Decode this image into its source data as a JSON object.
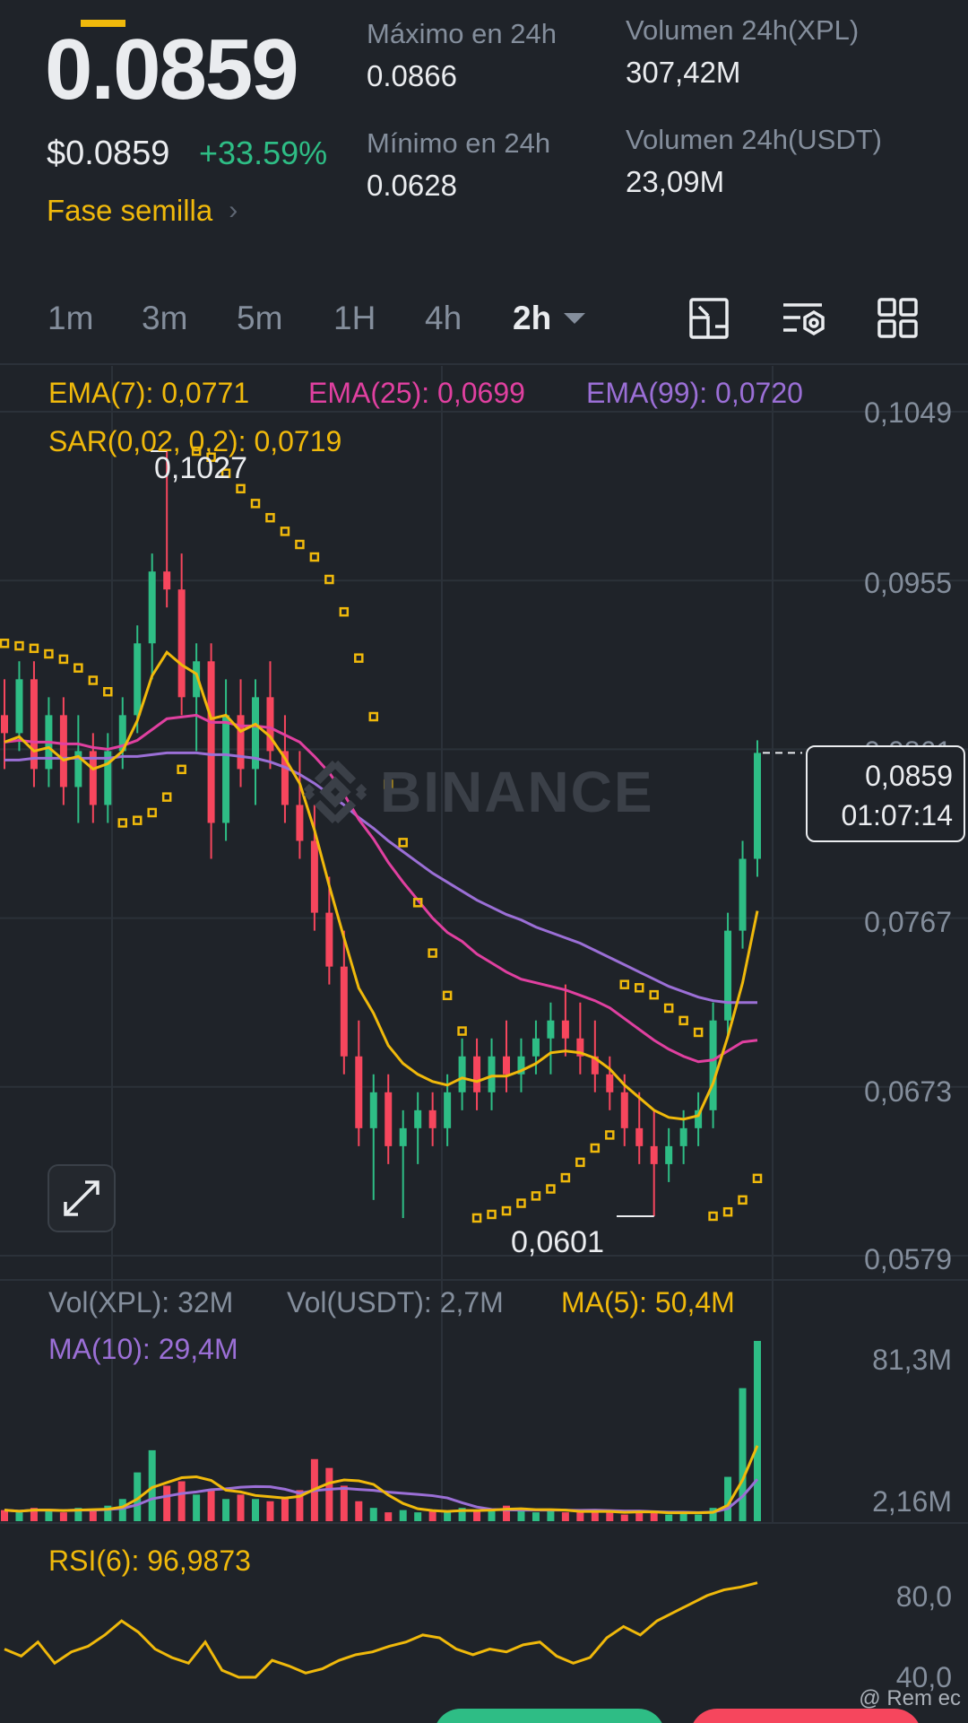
{
  "header": {
    "price": "0.0859",
    "price_usd": "$0.0859",
    "change": "+33.59%",
    "seed_label": "Fase semilla",
    "stats": [
      {
        "label": "Máximo en 24h",
        "value": "0.0866"
      },
      {
        "label": "Volumen 24h(XPL)",
        "value": "307,42M"
      },
      {
        "label": "Mínimo en 24h",
        "value": "0.0628"
      },
      {
        "label": "Volumen 24h(USDT)",
        "value": "23,09M"
      }
    ]
  },
  "intervals": [
    "1m",
    "3m",
    "5m",
    "1H",
    "4h",
    "2h"
  ],
  "active_interval": "2h",
  "indicators": {
    "ema7": "EMA(7): 0,0771",
    "ema25": "EMA(25): 0,0699",
    "ema99": "EMA(99): 0,0720",
    "sar": "SAR(0,02, 0,2): 0,0719",
    "vol_xpl": "Vol(XPL): 32M",
    "vol_usdt": "Vol(USDT): 2,7M",
    "ma5": "MA(5): 50,4M",
    "ma10": "MA(10): 29,4M",
    "rsi": "RSI(6): 96,9873"
  },
  "price_axis": [
    "0,1049",
    "0,0955",
    "0,0861",
    "0,0767",
    "0,0673",
    "0,0579"
  ],
  "volume_axis": [
    "81,3M",
    "2,16M"
  ],
  "rsi_axis": [
    "80,0",
    "40,0"
  ],
  "current_price_tag": {
    "price": "0,0859",
    "countdown": "01:07:14"
  },
  "annotations": {
    "high": "0,1027",
    "low": "0,0601"
  },
  "watermark": "BINANCE",
  "footer_credit": "@ Rem ec",
  "colors": {
    "up": "#2ebd85",
    "down": "#f6465d",
    "ema7": "#f0b90b",
    "ema25": "#e040a0",
    "ema99": "#9b6fd6",
    "sar": "#f0b90b",
    "accent": "#f0b90b",
    "bg": "#1f2329"
  },
  "chart_data": {
    "type": "candlestick",
    "ylim": [
      0.0579,
      0.1049
    ],
    "candles": [
      [
        0.088,
        0.09,
        0.085,
        0.087
      ],
      [
        0.087,
        0.091,
        0.086,
        0.09
      ],
      [
        0.09,
        0.091,
        0.084,
        0.085
      ],
      [
        0.085,
        0.089,
        0.084,
        0.088
      ],
      [
        0.088,
        0.089,
        0.083,
        0.084
      ],
      [
        0.084,
        0.088,
        0.082,
        0.086
      ],
      [
        0.086,
        0.087,
        0.082,
        0.083
      ],
      [
        0.083,
        0.087,
        0.082,
        0.086
      ],
      [
        0.086,
        0.089,
        0.085,
        0.088
      ],
      [
        0.088,
        0.093,
        0.087,
        0.092
      ],
      [
        0.092,
        0.097,
        0.09,
        0.096
      ],
      [
        0.096,
        0.1027,
        0.094,
        0.095
      ],
      [
        0.095,
        0.097,
        0.088,
        0.089
      ],
      [
        0.089,
        0.092,
        0.086,
        0.091
      ],
      [
        0.091,
        0.092,
        0.08,
        0.082
      ],
      [
        0.082,
        0.09,
        0.081,
        0.088
      ],
      [
        0.088,
        0.09,
        0.084,
        0.085
      ],
      [
        0.085,
        0.09,
        0.083,
        0.089
      ],
      [
        0.089,
        0.091,
        0.085,
        0.086
      ],
      [
        0.086,
        0.088,
        0.082,
        0.083
      ],
      [
        0.083,
        0.086,
        0.08,
        0.081
      ],
      [
        0.081,
        0.083,
        0.076,
        0.077
      ],
      [
        0.077,
        0.079,
        0.073,
        0.074
      ],
      [
        0.074,
        0.076,
        0.068,
        0.069
      ],
      [
        0.069,
        0.071,
        0.064,
        0.065
      ],
      [
        0.065,
        0.068,
        0.061,
        0.067
      ],
      [
        0.067,
        0.068,
        0.063,
        0.064
      ],
      [
        0.064,
        0.066,
        0.06,
        0.065
      ],
      [
        0.065,
        0.067,
        0.063,
        0.066
      ],
      [
        0.066,
        0.067,
        0.064,
        0.065
      ],
      [
        0.065,
        0.068,
        0.064,
        0.067
      ],
      [
        0.067,
        0.07,
        0.066,
        0.069
      ],
      [
        0.069,
        0.07,
        0.066,
        0.067
      ],
      [
        0.067,
        0.07,
        0.066,
        0.069
      ],
      [
        0.069,
        0.071,
        0.067,
        0.068
      ],
      [
        0.068,
        0.07,
        0.067,
        0.069
      ],
      [
        0.069,
        0.071,
        0.068,
        0.07
      ],
      [
        0.07,
        0.072,
        0.068,
        0.071
      ],
      [
        0.071,
        0.073,
        0.069,
        0.07
      ],
      [
        0.07,
        0.072,
        0.068,
        0.069
      ],
      [
        0.069,
        0.071,
        0.067,
        0.068
      ],
      [
        0.068,
        0.069,
        0.066,
        0.067
      ],
      [
        0.067,
        0.068,
        0.064,
        0.065
      ],
      [
        0.065,
        0.067,
        0.063,
        0.064
      ],
      [
        0.064,
        0.066,
        0.0601,
        0.063
      ],
      [
        0.063,
        0.065,
        0.062,
        0.064
      ],
      [
        0.064,
        0.066,
        0.063,
        0.065
      ],
      [
        0.065,
        0.067,
        0.064,
        0.066
      ],
      [
        0.066,
        0.072,
        0.065,
        0.071
      ],
      [
        0.071,
        0.077,
        0.07,
        0.076
      ],
      [
        0.076,
        0.081,
        0.075,
        0.08
      ],
      [
        0.08,
        0.0866,
        0.079,
        0.0859
      ]
    ],
    "ema7": [
      0.0865,
      0.0868,
      0.086,
      0.0862,
      0.0855,
      0.0857,
      0.085,
      0.0853,
      0.086,
      0.0877,
      0.0902,
      0.0915,
      0.0908,
      0.0903,
      0.0878,
      0.088,
      0.0871,
      0.0875,
      0.0868,
      0.0856,
      0.0842,
      0.0816,
      0.0785,
      0.0756,
      0.0728,
      0.0714,
      0.0696,
      0.0686,
      0.068,
      0.0676,
      0.0674,
      0.0678,
      0.0676,
      0.0679,
      0.0679,
      0.0682,
      0.0686,
      0.0692,
      0.0693,
      0.0692,
      0.0689,
      0.0683,
      0.0674,
      0.0667,
      0.066,
      0.0656,
      0.0655,
      0.0657,
      0.0675,
      0.0701,
      0.0731,
      0.0771
    ],
    "ema25": [
      0.0865,
      0.0866,
      0.0865,
      0.0865,
      0.0864,
      0.0864,
      0.0862,
      0.0861,
      0.0863,
      0.0866,
      0.0872,
      0.0878,
      0.0879,
      0.088,
      0.0876,
      0.0876,
      0.0874,
      0.0874,
      0.0873,
      0.0869,
      0.0865,
      0.0857,
      0.0848,
      0.0836,
      0.0822,
      0.0811,
      0.0798,
      0.0787,
      0.0777,
      0.0767,
      0.0759,
      0.0754,
      0.0747,
      0.0742,
      0.0737,
      0.0733,
      0.0731,
      0.0729,
      0.0727,
      0.0724,
      0.0721,
      0.0717,
      0.0711,
      0.0705,
      0.0699,
      0.0694,
      0.069,
      0.0687,
      0.0688,
      0.0693,
      0.0698,
      0.0699
    ],
    "ema99": [
      0.0855,
      0.0855,
      0.0856,
      0.0856,
      0.0856,
      0.0856,
      0.0856,
      0.0856,
      0.0857,
      0.0857,
      0.0858,
      0.0859,
      0.0859,
      0.0859,
      0.0858,
      0.0858,
      0.0857,
      0.0856,
      0.0854,
      0.0851,
      0.0847,
      0.0842,
      0.0836,
      0.083,
      0.0823,
      0.0817,
      0.081,
      0.0804,
      0.0798,
      0.0792,
      0.0787,
      0.0782,
      0.0777,
      0.0773,
      0.0769,
      0.0766,
      0.0762,
      0.0759,
      0.0756,
      0.0753,
      0.0749,
      0.0745,
      0.0741,
      0.0737,
      0.0733,
      0.0729,
      0.0726,
      0.0723,
      0.0721,
      0.072,
      0.072,
      0.072
    ],
    "volume_max_m": 81.3,
    "volumes_m": [
      5,
      4,
      6,
      5,
      4,
      6,
      5,
      7,
      10,
      22,
      32,
      16,
      18,
      12,
      14,
      10,
      12,
      10,
      9,
      11,
      14,
      28,
      24,
      16,
      9,
      6,
      4,
      5,
      4,
      5,
      4,
      6,
      5,
      5,
      7,
      5,
      4,
      5,
      4,
      4,
      5,
      4,
      3,
      5,
      4,
      3,
      4,
      3,
      6,
      20,
      60,
      81.3
    ],
    "rsi": [
      50,
      45,
      55,
      40,
      48,
      52,
      60,
      70,
      62,
      50,
      44,
      40,
      55,
      35,
      30,
      30,
      42,
      38,
      33,
      36,
      42,
      46,
      48,
      52,
      55,
      60,
      58,
      50,
      46,
      50,
      48,
      53,
      55,
      45,
      40,
      44,
      58,
      66,
      60,
      70,
      76,
      82,
      88,
      92,
      94,
      96.99
    ]
  }
}
